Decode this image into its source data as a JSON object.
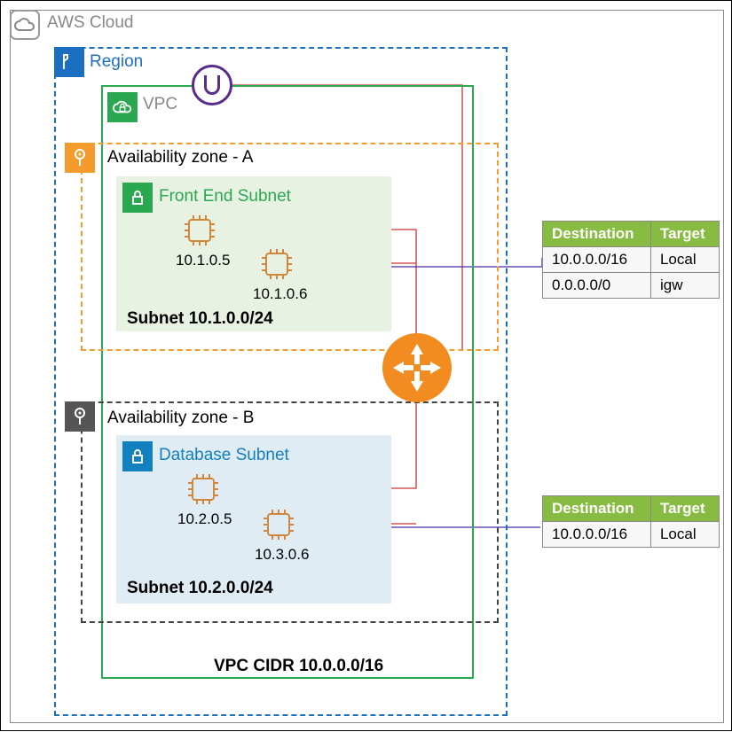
{
  "cloud": {
    "label": "AWS Cloud"
  },
  "region": {
    "label": "Region"
  },
  "vpc": {
    "label": "VPC",
    "cidr_label": "VPC CIDR 10.0.0.0/16"
  },
  "az_a": {
    "label": "Availability zone - A",
    "subnet": {
      "label": "Front End Subnet",
      "cidr": "Subnet 10.1.0.0/24",
      "instances": [
        {
          "ip": "10.1.0.5"
        },
        {
          "ip": "10.1.0.6"
        }
      ]
    }
  },
  "az_b": {
    "label": "Availability zone - B",
    "subnet": {
      "label": "Database Subnet",
      "cidr": "Subnet 10.2.0.0/24",
      "instances": [
        {
          "ip": "10.2.0.5"
        },
        {
          "ip": "10.3.0.6"
        }
      ]
    }
  },
  "rt1": {
    "headers": {
      "dest": "Destination",
      "target": "Target"
    },
    "rows": [
      {
        "dest": "10.0.0.0/16",
        "target": "Local"
      },
      {
        "dest": "0.0.0.0/0",
        "target": "igw"
      }
    ]
  },
  "rt2": {
    "headers": {
      "dest": "Destination",
      "target": "Target"
    },
    "rows": [
      {
        "dest": "10.0.0.0/16",
        "target": "Local"
      }
    ]
  },
  "colors": {
    "region": "#1b6ec2",
    "vpc_green": "#2aa84f",
    "orange": "#f49b2d",
    "router": "#f28c20",
    "igw": "#5b2d8a",
    "db_blue": "#127fbf",
    "table_header": "#87bb41"
  }
}
